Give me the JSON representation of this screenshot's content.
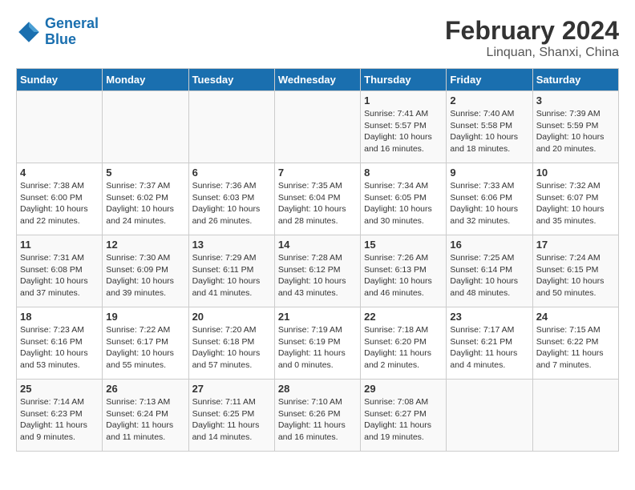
{
  "header": {
    "logo_line1": "General",
    "logo_line2": "Blue",
    "main_title": "February 2024",
    "subtitle": "Linquan, Shanxi, China"
  },
  "days_of_week": [
    "Sunday",
    "Monday",
    "Tuesday",
    "Wednesday",
    "Thursday",
    "Friday",
    "Saturday"
  ],
  "weeks": [
    [
      {
        "day": "",
        "info": ""
      },
      {
        "day": "",
        "info": ""
      },
      {
        "day": "",
        "info": ""
      },
      {
        "day": "",
        "info": ""
      },
      {
        "day": "1",
        "info": "Sunrise: 7:41 AM\nSunset: 5:57 PM\nDaylight: 10 hours\nand 16 minutes."
      },
      {
        "day": "2",
        "info": "Sunrise: 7:40 AM\nSunset: 5:58 PM\nDaylight: 10 hours\nand 18 minutes."
      },
      {
        "day": "3",
        "info": "Sunrise: 7:39 AM\nSunset: 5:59 PM\nDaylight: 10 hours\nand 20 minutes."
      }
    ],
    [
      {
        "day": "4",
        "info": "Sunrise: 7:38 AM\nSunset: 6:00 PM\nDaylight: 10 hours\nand 22 minutes."
      },
      {
        "day": "5",
        "info": "Sunrise: 7:37 AM\nSunset: 6:02 PM\nDaylight: 10 hours\nand 24 minutes."
      },
      {
        "day": "6",
        "info": "Sunrise: 7:36 AM\nSunset: 6:03 PM\nDaylight: 10 hours\nand 26 minutes."
      },
      {
        "day": "7",
        "info": "Sunrise: 7:35 AM\nSunset: 6:04 PM\nDaylight: 10 hours\nand 28 minutes."
      },
      {
        "day": "8",
        "info": "Sunrise: 7:34 AM\nSunset: 6:05 PM\nDaylight: 10 hours\nand 30 minutes."
      },
      {
        "day": "9",
        "info": "Sunrise: 7:33 AM\nSunset: 6:06 PM\nDaylight: 10 hours\nand 32 minutes."
      },
      {
        "day": "10",
        "info": "Sunrise: 7:32 AM\nSunset: 6:07 PM\nDaylight: 10 hours\nand 35 minutes."
      }
    ],
    [
      {
        "day": "11",
        "info": "Sunrise: 7:31 AM\nSunset: 6:08 PM\nDaylight: 10 hours\nand 37 minutes."
      },
      {
        "day": "12",
        "info": "Sunrise: 7:30 AM\nSunset: 6:09 PM\nDaylight: 10 hours\nand 39 minutes."
      },
      {
        "day": "13",
        "info": "Sunrise: 7:29 AM\nSunset: 6:11 PM\nDaylight: 10 hours\nand 41 minutes."
      },
      {
        "day": "14",
        "info": "Sunrise: 7:28 AM\nSunset: 6:12 PM\nDaylight: 10 hours\nand 43 minutes."
      },
      {
        "day": "15",
        "info": "Sunrise: 7:26 AM\nSunset: 6:13 PM\nDaylight: 10 hours\nand 46 minutes."
      },
      {
        "day": "16",
        "info": "Sunrise: 7:25 AM\nSunset: 6:14 PM\nDaylight: 10 hours\nand 48 minutes."
      },
      {
        "day": "17",
        "info": "Sunrise: 7:24 AM\nSunset: 6:15 PM\nDaylight: 10 hours\nand 50 minutes."
      }
    ],
    [
      {
        "day": "18",
        "info": "Sunrise: 7:23 AM\nSunset: 6:16 PM\nDaylight: 10 hours\nand 53 minutes."
      },
      {
        "day": "19",
        "info": "Sunrise: 7:22 AM\nSunset: 6:17 PM\nDaylight: 10 hours\nand 55 minutes."
      },
      {
        "day": "20",
        "info": "Sunrise: 7:20 AM\nSunset: 6:18 PM\nDaylight: 10 hours\nand 57 minutes."
      },
      {
        "day": "21",
        "info": "Sunrise: 7:19 AM\nSunset: 6:19 PM\nDaylight: 11 hours\nand 0 minutes."
      },
      {
        "day": "22",
        "info": "Sunrise: 7:18 AM\nSunset: 6:20 PM\nDaylight: 11 hours\nand 2 minutes."
      },
      {
        "day": "23",
        "info": "Sunrise: 7:17 AM\nSunset: 6:21 PM\nDaylight: 11 hours\nand 4 minutes."
      },
      {
        "day": "24",
        "info": "Sunrise: 7:15 AM\nSunset: 6:22 PM\nDaylight: 11 hours\nand 7 minutes."
      }
    ],
    [
      {
        "day": "25",
        "info": "Sunrise: 7:14 AM\nSunset: 6:23 PM\nDaylight: 11 hours\nand 9 minutes."
      },
      {
        "day": "26",
        "info": "Sunrise: 7:13 AM\nSunset: 6:24 PM\nDaylight: 11 hours\nand 11 minutes."
      },
      {
        "day": "27",
        "info": "Sunrise: 7:11 AM\nSunset: 6:25 PM\nDaylight: 11 hours\nand 14 minutes."
      },
      {
        "day": "28",
        "info": "Sunrise: 7:10 AM\nSunset: 6:26 PM\nDaylight: 11 hours\nand 16 minutes."
      },
      {
        "day": "29",
        "info": "Sunrise: 7:08 AM\nSunset: 6:27 PM\nDaylight: 11 hours\nand 19 minutes."
      },
      {
        "day": "",
        "info": ""
      },
      {
        "day": "",
        "info": ""
      }
    ]
  ]
}
